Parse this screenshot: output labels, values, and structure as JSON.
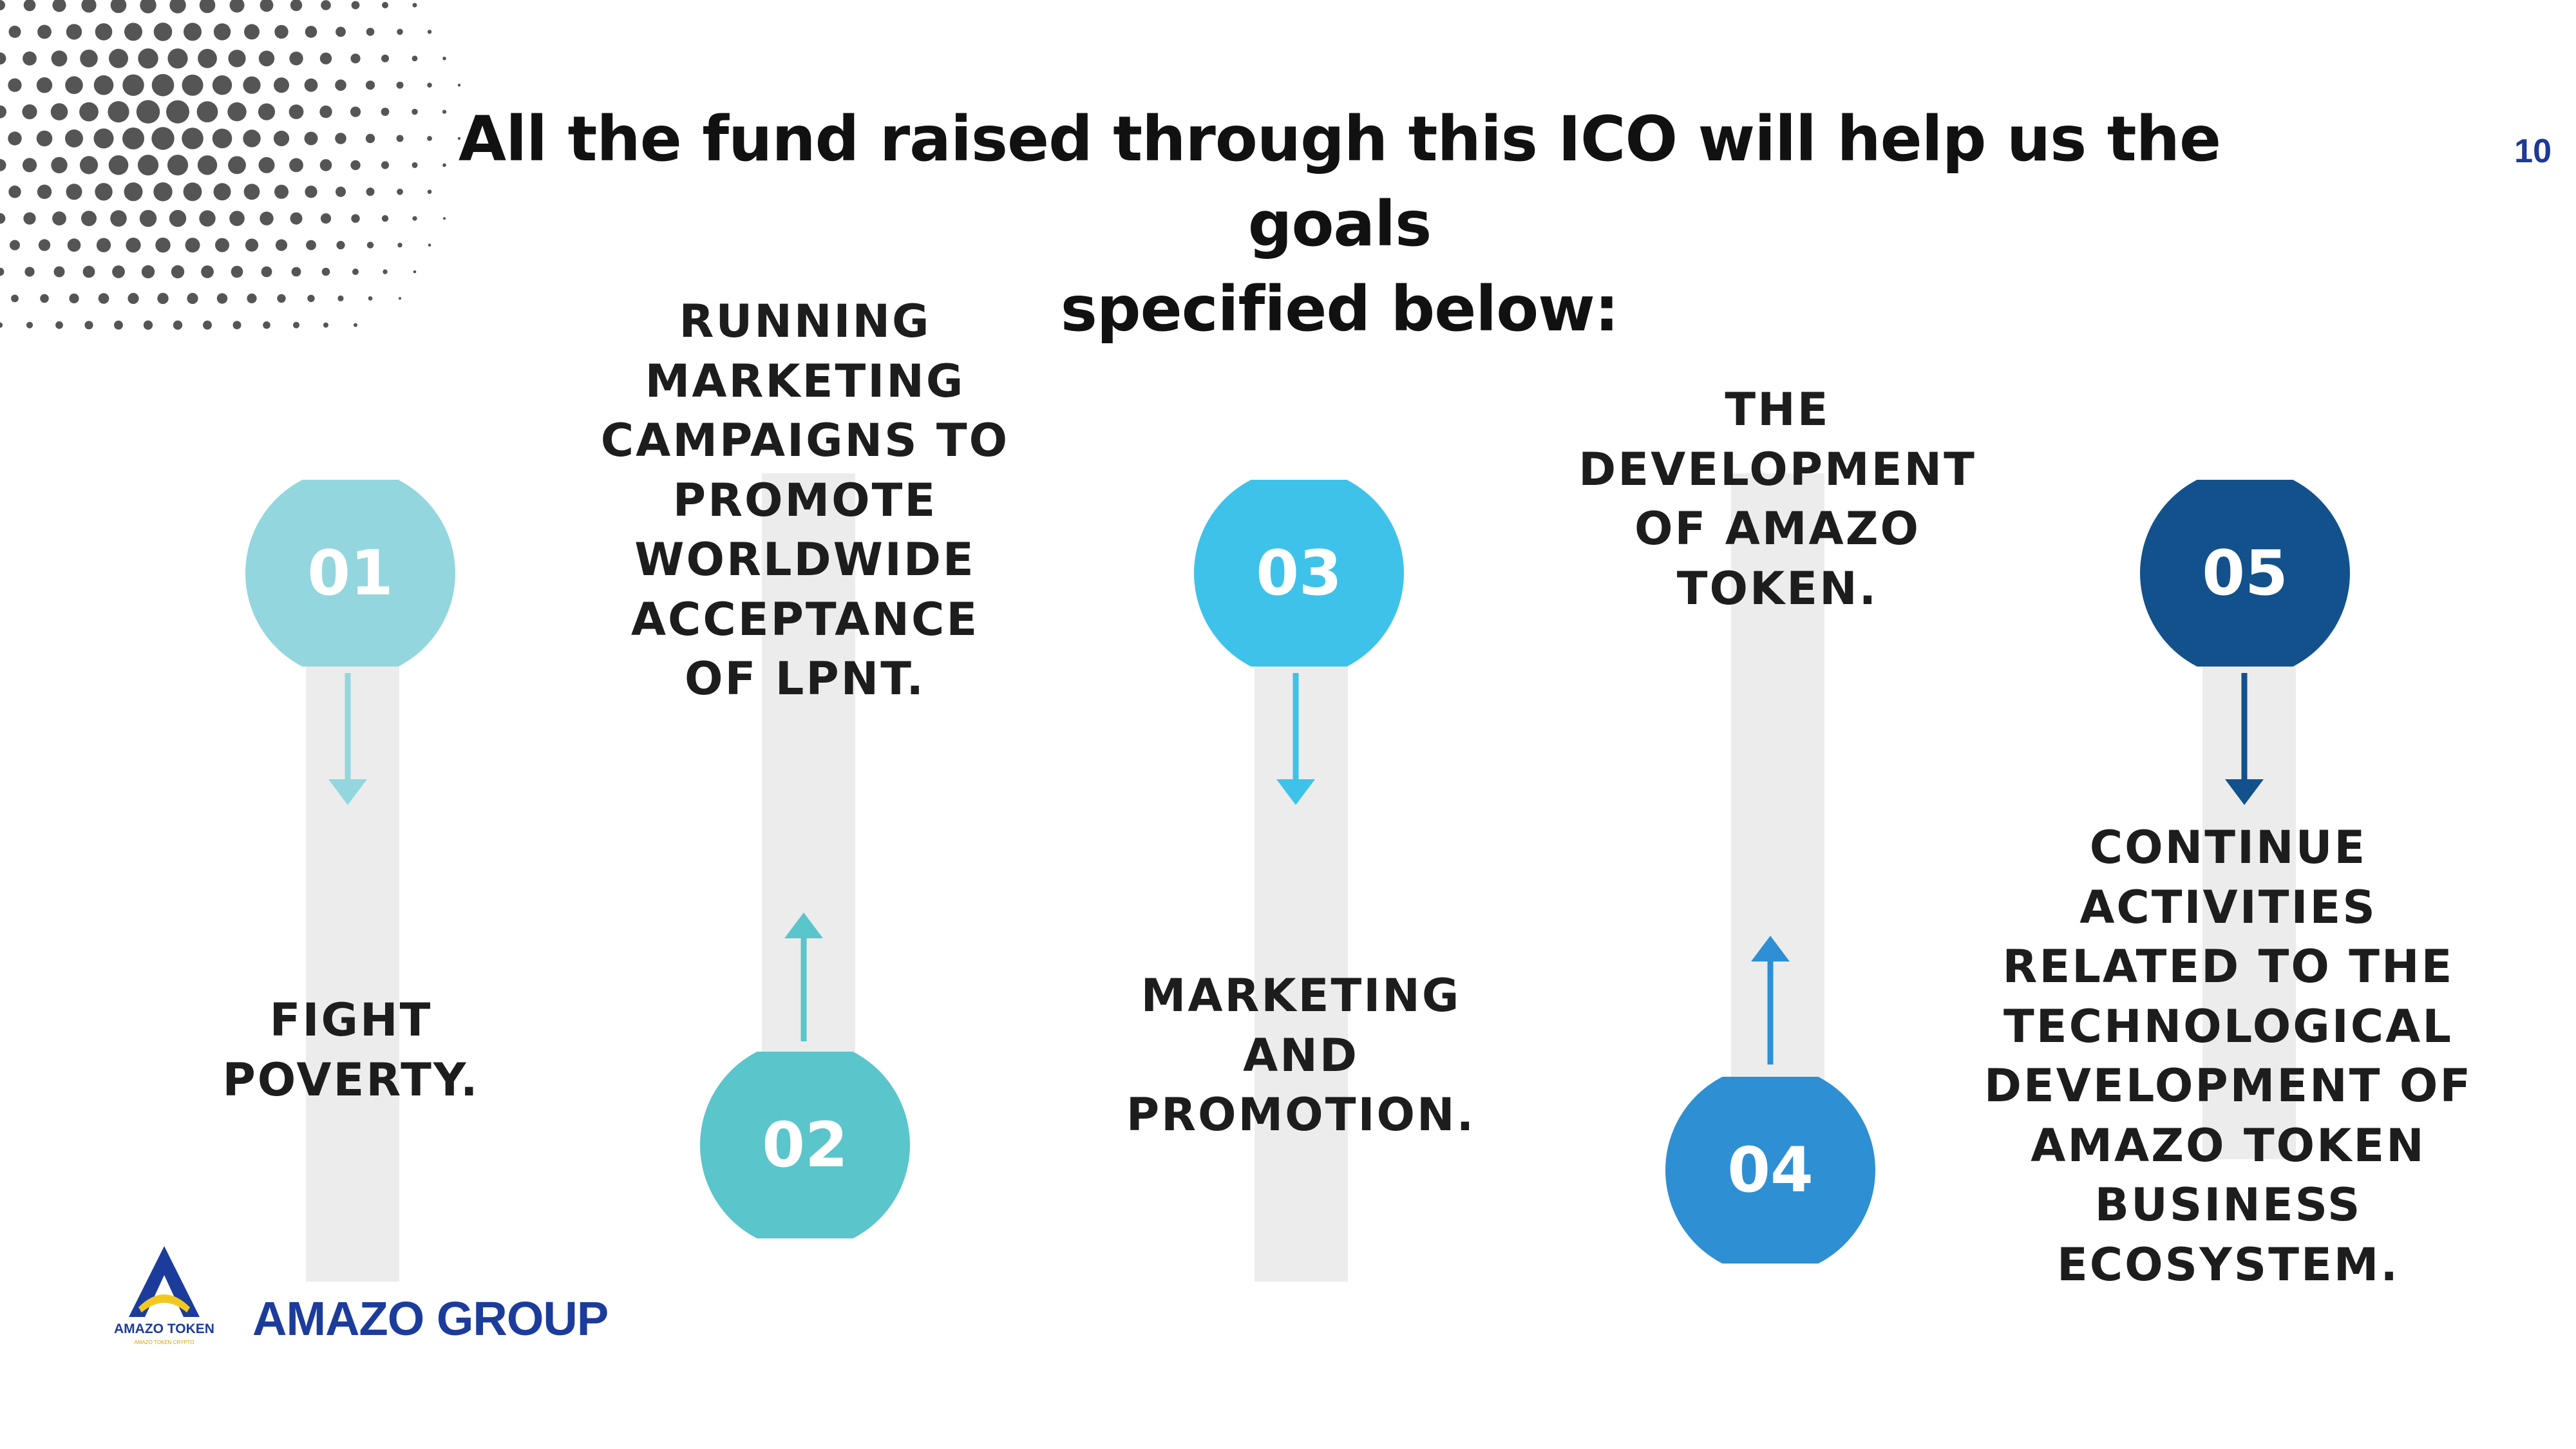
{
  "slide": {
    "title_line1": "All the fund raised through this ICO will help us the goals",
    "title_line2": "specified below:",
    "page_number": "10"
  },
  "goals": [
    {
      "number": "01",
      "color": "#93d6de",
      "text_lines": [
        "FIGHT",
        "POVERTY."
      ]
    },
    {
      "number": "02",
      "color": "#5ac5cb",
      "text_lines": [
        "RUNNING",
        "MARKETING",
        "CAMPAIGNS TO",
        "PROMOTE",
        "WORLDWIDE",
        "ACCEPTANCE",
        "OF LPNT."
      ]
    },
    {
      "number": "03",
      "color": "#3fc2ea",
      "text_lines": [
        "MARKETING",
        "AND",
        "PROMOTION."
      ]
    },
    {
      "number": "04",
      "color": "#2e8fd3",
      "text_lines": [
        "THE",
        "DEVELOPMENT",
        "OF AMAZO",
        "TOKEN."
      ]
    },
    {
      "number": "05",
      "color": "#13518c",
      "text_lines": [
        "CONTINUE",
        "ACTIVITIES",
        "RELATED TO THE",
        "TECHNOLOGICAL",
        "DEVELOPMENT OF",
        "AMAZO TOKEN",
        "BUSINESS",
        "ECOSYSTEM."
      ]
    }
  ],
  "arrows": {
    "up": "arrow-up-icon",
    "down": "arrow-down-icon"
  },
  "footer": {
    "logo_caption": "AMAZO TOKEN",
    "logo_subcaption": "AMAZO TOKEN CRYPTO",
    "brand_name": "AMAZO GROUP"
  },
  "colors": {
    "title": "#111111",
    "page_number": "#1f3a93",
    "bar": "#ececec",
    "brand": "#1c3c9c",
    "dots": "#555555"
  }
}
